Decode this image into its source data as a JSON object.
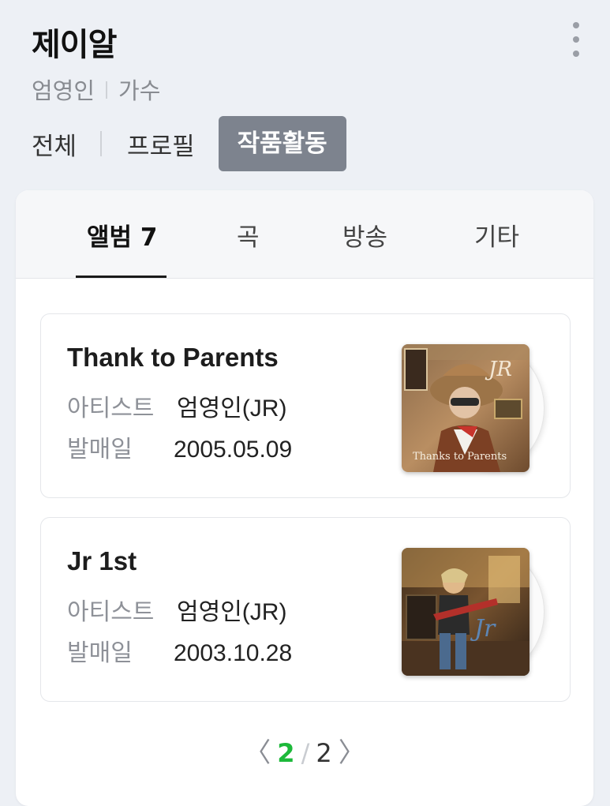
{
  "header": {
    "title": "제이알",
    "name": "엄영인",
    "job": "가수"
  },
  "top_tabs": {
    "all": "전체",
    "profile": "프로필",
    "works": "작품활동"
  },
  "sub_tabs": {
    "album": "앨범 7",
    "song": "곡",
    "broadcast": "방송",
    "etc": "기타"
  },
  "albums": [
    {
      "title": "Thank to Parents",
      "artist_label": "아티스트",
      "artist": "엄영인(JR)",
      "date_label": "발매일",
      "date": "2005.05.09",
      "cover_logo": "JR",
      "cover_caption": "Thanks to Parents"
    },
    {
      "title": "Jr 1st",
      "artist_label": "아티스트",
      "artist": "엄영인(JR)",
      "date_label": "발매일",
      "date": "2003.10.28",
      "cover_logo": "Jr"
    }
  ],
  "pager": {
    "prev": "〈",
    "current": "2",
    "slash": "/",
    "total": "2",
    "next": "〉"
  },
  "colors": {
    "active_tab_bg": "#7d838e",
    "pager_current": "#1db93a"
  },
  "icons": [
    "more-vertical-icon",
    "chevron-left-icon",
    "chevron-right-icon"
  ]
}
